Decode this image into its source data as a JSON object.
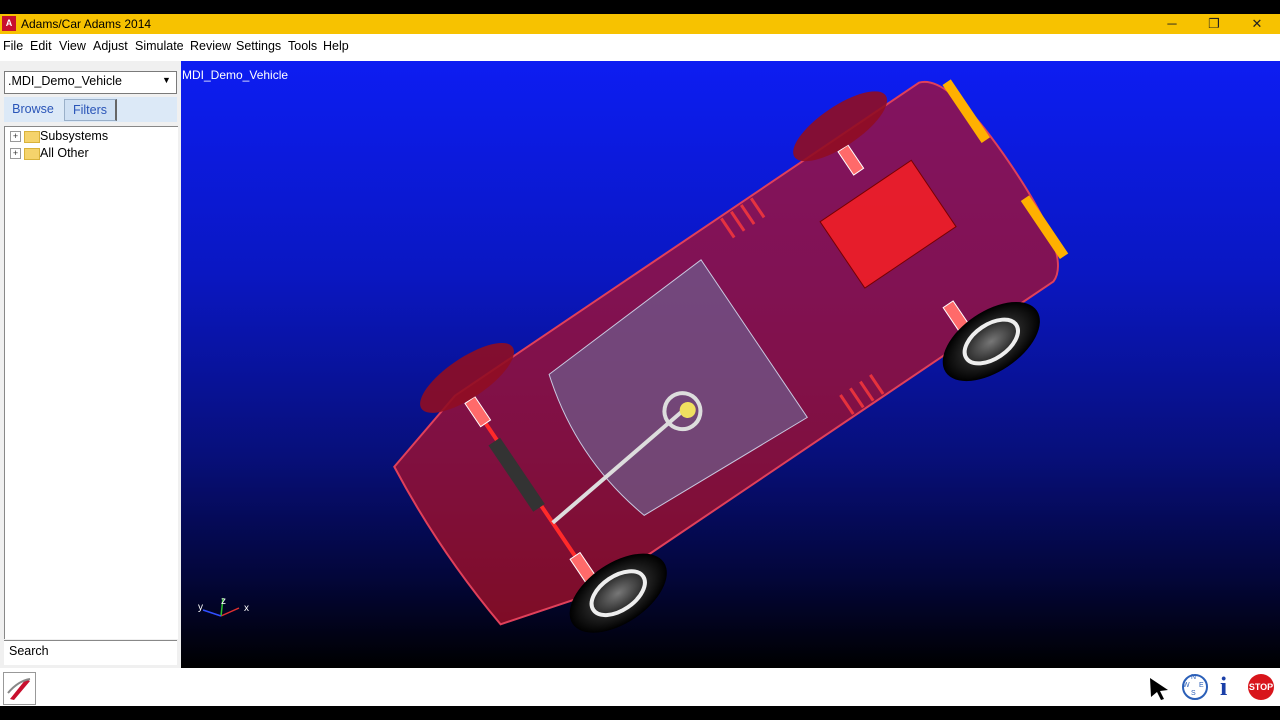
{
  "window": {
    "logo_letter": "A",
    "title": "Adams/Car Adams 2014",
    "controls": {
      "minimize": "─",
      "restore": "❐",
      "close": "✕"
    }
  },
  "menu": [
    "File",
    "Edit",
    "View",
    "Adjust",
    "Simulate",
    "Review",
    "Settings",
    "Tools",
    "Help"
  ],
  "browser": {
    "model_select_value": ".MDI_Demo_Vehicle",
    "tabs": [
      "Browse",
      "Filters"
    ],
    "active_tab": "Filters",
    "tree": [
      {
        "label": "Subsystems",
        "expander": "+"
      },
      {
        "label": "All Other",
        "expander": "+"
      }
    ],
    "search_label": "Search"
  },
  "viewport": {
    "label": "MDI_Demo_Vehicle",
    "triad": {
      "y": "y",
      "z": "z",
      "x": "x"
    }
  },
  "toolbar": {
    "select_icon": "cursor-arrow-icon",
    "compass_letters": [
      "N",
      "W",
      "E",
      "S"
    ],
    "info_glyph": "i",
    "stop_label": "STOP"
  },
  "colors": {
    "title_bar": "#f7c200",
    "viewport_top": "#0d1df2",
    "car_body": "#c8102e",
    "stop_button": "#d8151b"
  }
}
